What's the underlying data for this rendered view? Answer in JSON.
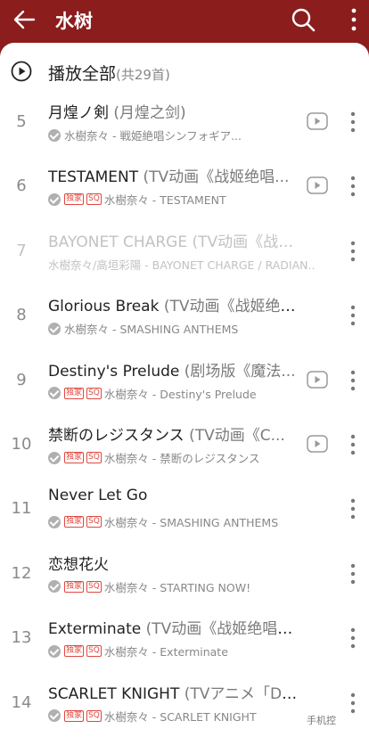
{
  "header": {
    "title": "水树"
  },
  "playall": {
    "label": "播放全部",
    "count": "(共29首)"
  },
  "songs": [
    {
      "num": "5",
      "title": "月煌ノ剣",
      "alt": " (月煌之剑)",
      "badges": [],
      "meta": "水樹奈々 - 戦姫絶唱シンフォギア...",
      "mv": true,
      "dim": false
    },
    {
      "num": "6",
      "title": "TESTAMENT",
      "alt": " (TV动画《战姬绝唱...",
      "badges": [
        "独家",
        "SQ"
      ],
      "meta": "水樹奈々 - TESTAMENT",
      "mv": true,
      "dim": false
    },
    {
      "num": "7",
      "title": "BAYONET CHARGE",
      "alt": " (TV动画《战姬绝唱...",
      "badges": [],
      "meta": "水樹奈々/高垣彩陽 - BAYONET CHARGE / RADIAN...",
      "mv": false,
      "dim": true
    },
    {
      "num": "8",
      "title": "Glorious Break",
      "alt": " (TV动画《战姬绝唱GX...",
      "badges": [],
      "meta": "水樹奈々 - SMASHING ANTHEMS",
      "mv": false,
      "dim": false
    },
    {
      "num": "9",
      "title": "Destiny's Prelude",
      "alt": " (剧场版《魔法...",
      "badges": [
        "独家",
        "SQ"
      ],
      "meta": "水樹奈々 - Destiny's Prelude",
      "mv": true,
      "dim": false
    },
    {
      "num": "10",
      "title": "禁断のレジスタンス",
      "alt": " (TV动画《C...",
      "badges": [
        "独家",
        "SQ"
      ],
      "meta": "水樹奈々 - 禁断のレジスタンス",
      "mv": true,
      "dim": false
    },
    {
      "num": "11",
      "title": "Never Let Go",
      "alt": "",
      "badges": [
        "独家",
        "SQ"
      ],
      "meta": "水樹奈々 - SMASHING ANTHEMS",
      "mv": false,
      "dim": false
    },
    {
      "num": "12",
      "title": "恋想花火",
      "alt": "",
      "badges": [
        "独家",
        "SQ"
      ],
      "meta": "水樹奈々 - STARTING NOW!",
      "mv": false,
      "dim": false
    },
    {
      "num": "13",
      "title": "Exterminate",
      "alt": " (TV动画《战姬绝唱SYMP...",
      "badges": [
        "独家",
        "SQ"
      ],
      "meta": "水樹奈々 - Exterminate",
      "mv": false,
      "dim": false
    },
    {
      "num": "14",
      "title": "SCARLET KNIGHT",
      "alt": " (TVアニメ「DOG DA...",
      "badges": [
        "独家",
        "SQ"
      ],
      "meta": "水樹奈々 - SCARLET KNIGHT",
      "mv": false,
      "dim": false
    }
  ],
  "watermark": "手机控"
}
